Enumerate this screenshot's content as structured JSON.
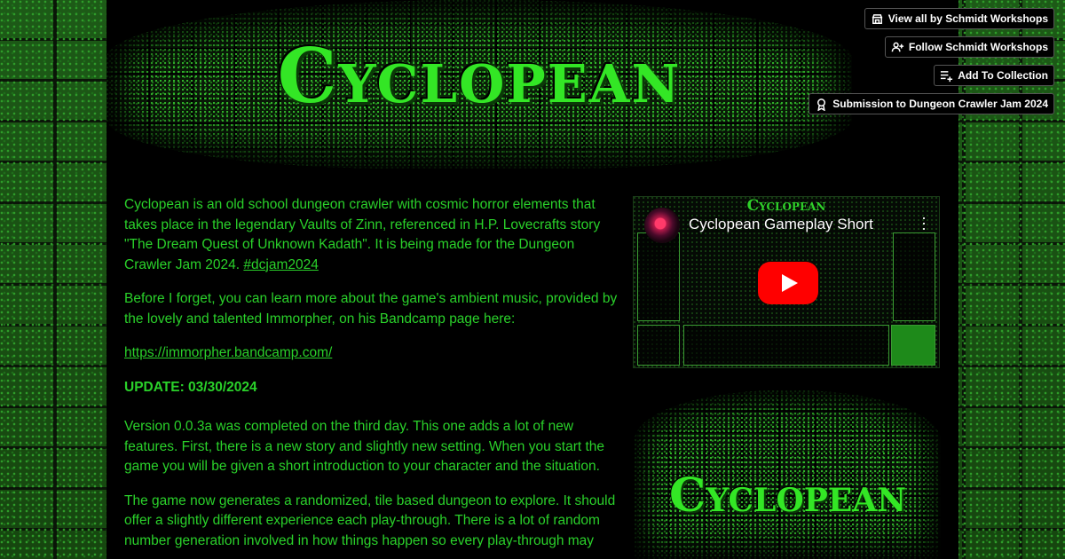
{
  "banner": {
    "logo_text": "Cyclopean"
  },
  "actions": {
    "view_all": "View all by Schmidt Workshops",
    "follow": "Follow Schmidt Workshops",
    "add_collection": "Add To Collection",
    "submission": "Submission to Dungeon Crawler Jam 2024"
  },
  "description": {
    "p1_text": "Cyclopean is an old school dungeon crawler with cosmic horror elements that takes place in the legendary Vaults of Zinn, referenced in H.P. Lovecrafts story \"The Dream Quest of Unknown Kadath\".  It is being made for the Dungeon Crawler Jam 2024. ",
    "p1_tag": "#dcjam2024",
    "p2": "Before I forget, you can learn more about the game's ambient music, provided by the lovely and talented Immorpher, on his Bandcamp page here:",
    "link": "https://immorpher.bandcamp.com/",
    "update": "UPDATE: 03/30/2024",
    "p3": "Version 0.0.3a was completed on the third day.  This one adds a lot of new features.  First, there is a new story and slightly new setting.  When you start the game you will be given a short introduction to your character and the situation.",
    "p4": "The game now generates a randomized, tile based dungeon to explore.  It should offer a slightly different experience each play-through.  There is a lot of random number generation involved in how things happen so every play-through may"
  },
  "video": {
    "title": "Cyclopean Gameplay Short",
    "art_title": "Cyclopean"
  },
  "side_art": {
    "logo_text": "Cyclopean"
  },
  "colors": {
    "text": "#2ad12a",
    "logo": "#33e625",
    "page_bg": "#000000",
    "yt_red": "#ff0000"
  }
}
